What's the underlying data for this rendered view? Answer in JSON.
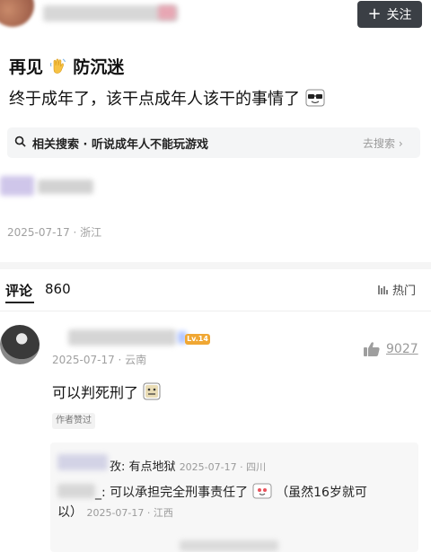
{
  "header": {
    "follow_label": "关注"
  },
  "post": {
    "title": "再见",
    "title_suffix": "防沉迷",
    "body": "终于成年了，该干点成年人该干的事情了",
    "meta": "2025-07-17 · 浙江"
  },
  "related_search": {
    "label": "相关搜索 · 听说成年人不能玩游戏",
    "action": "去搜索 ›"
  },
  "comments": {
    "label": "评论",
    "count": "860",
    "sort": "热门",
    "items": [
      {
        "level_badge": "Lv.14",
        "meta": "2025-07-17 · 云南",
        "likes": "9027",
        "text": "可以判死刑了",
        "author_badge": "作者赞过",
        "replies": [
          {
            "name_tail": "孜:",
            "text": "有点地狱",
            "meta": "2025-07-17 · 四川"
          },
          {
            "name_tail": "_:",
            "text_1": "可以承担完全刑事责任了",
            "text_2": "（虽然16岁就可",
            "text_3": "以）",
            "meta": "2025-07-17 · 江西"
          }
        ]
      }
    ]
  },
  "colors": {
    "follow_bg": "#3b3f45",
    "level_badge": "#f0a733",
    "meta_gray": "#a0a0a0"
  }
}
